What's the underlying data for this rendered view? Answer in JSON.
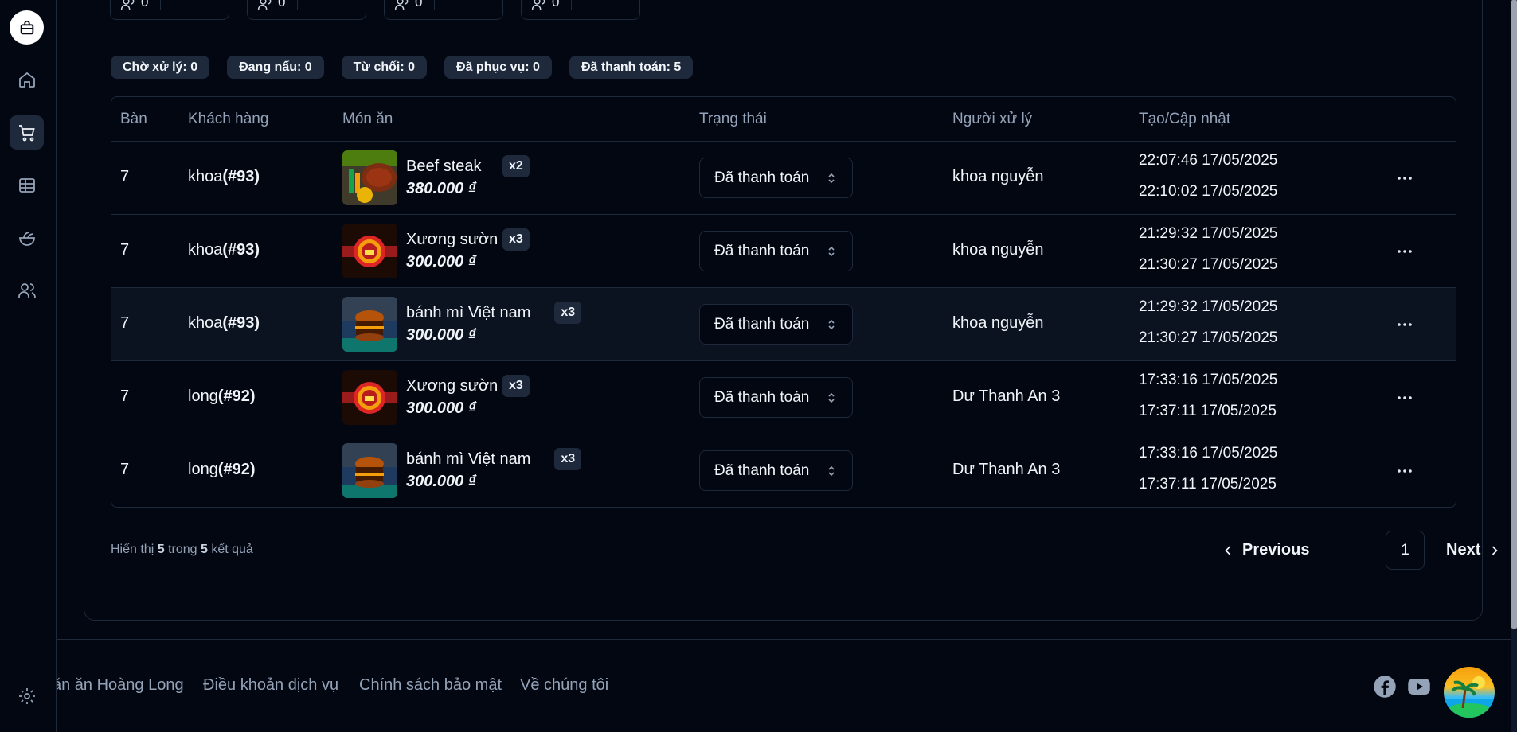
{
  "sidebar": {
    "logo_icon": "shopping-bag-icon",
    "items": [
      {
        "icon": "home-icon",
        "active": false
      },
      {
        "icon": "cart-icon",
        "active": true
      },
      {
        "icon": "table-icon",
        "active": false
      },
      {
        "icon": "salad-icon",
        "active": false
      },
      {
        "icon": "users-icon",
        "active": false
      }
    ],
    "settings_icon": "gear-icon"
  },
  "summary_boxes": [
    {
      "value": "0"
    },
    {
      "value": "0"
    },
    {
      "value": "0"
    },
    {
      "value": "0"
    }
  ],
  "status_badges": [
    "Chờ xử lý: 0",
    "Đang nấu: 0",
    "Từ chối: 0",
    "Đã phục vụ: 0",
    "Đã thanh toán: 5"
  ],
  "table": {
    "headers": [
      "Bàn",
      "Khách hàng",
      "Món ăn",
      "Trạng thái",
      "Người xử lý",
      "Tạo/Cập nhật"
    ],
    "rows": [
      {
        "table": "7",
        "customer": "khoa",
        "customer_id": "(#93)",
        "dish": "Beef steak",
        "qty": "x2",
        "price": "380.000 ₫",
        "status": "Đã thanh toán",
        "handler": "khoa nguyễn",
        "created": "22:07:46 17/05/2025",
        "updated": "22:10:02 17/05/2025",
        "thumb": "steak"
      },
      {
        "table": "7",
        "customer": "khoa",
        "customer_id": "(#93)",
        "dish": "Xương sườn",
        "qty": "x3",
        "price": "300.000 ₫",
        "status": "Đã thanh toán",
        "handler": "khoa nguyễn",
        "created": "21:29:32 17/05/2025",
        "updated": "21:30:27 17/05/2025",
        "thumb": "crest"
      },
      {
        "table": "7",
        "customer": "khoa",
        "customer_id": "(#93)",
        "dish": "bánh mì Việt nam",
        "qty": "x3",
        "price": "300.000 ₫",
        "status": "Đã thanh toán",
        "handler": "khoa nguyễn",
        "created": "21:29:32 17/05/2025",
        "updated": "21:30:27 17/05/2025",
        "thumb": "burger"
      },
      {
        "table": "7",
        "customer": "long",
        "customer_id": "(#92)",
        "dish": "Xương sườn",
        "qty": "x3",
        "price": "300.000 ₫",
        "status": "Đã thanh toán",
        "handler": "Dư Thanh An 3",
        "created": "17:33:16 17/05/2025",
        "updated": "17:37:11 17/05/2025",
        "thumb": "crest"
      },
      {
        "table": "7",
        "customer": "long",
        "customer_id": "(#92)",
        "dish": "bánh mì Việt nam",
        "qty": "x3",
        "price": "300.000 ₫",
        "status": "Đã thanh toán",
        "handler": "Dư Thanh An 3",
        "created": "17:33:16 17/05/2025",
        "updated": "17:37:11 17/05/2025",
        "thumb": "burger"
      }
    ]
  },
  "results": {
    "prefix": "Hiển thị",
    "shown": "5",
    "middle": "trong",
    "total": "5",
    "suffix": "kết quả"
  },
  "pagination": {
    "previous": "Previous",
    "page": "1",
    "next": "Next"
  },
  "footer": {
    "links": [
      "ăn ăn Hoàng Long",
      "Điều khoản dịch vụ",
      "Chính sách bảo mật",
      "Về chúng tôi"
    ],
    "social": [
      "facebook-icon",
      "youtube-icon"
    ],
    "avatar": "beach-avatar"
  }
}
